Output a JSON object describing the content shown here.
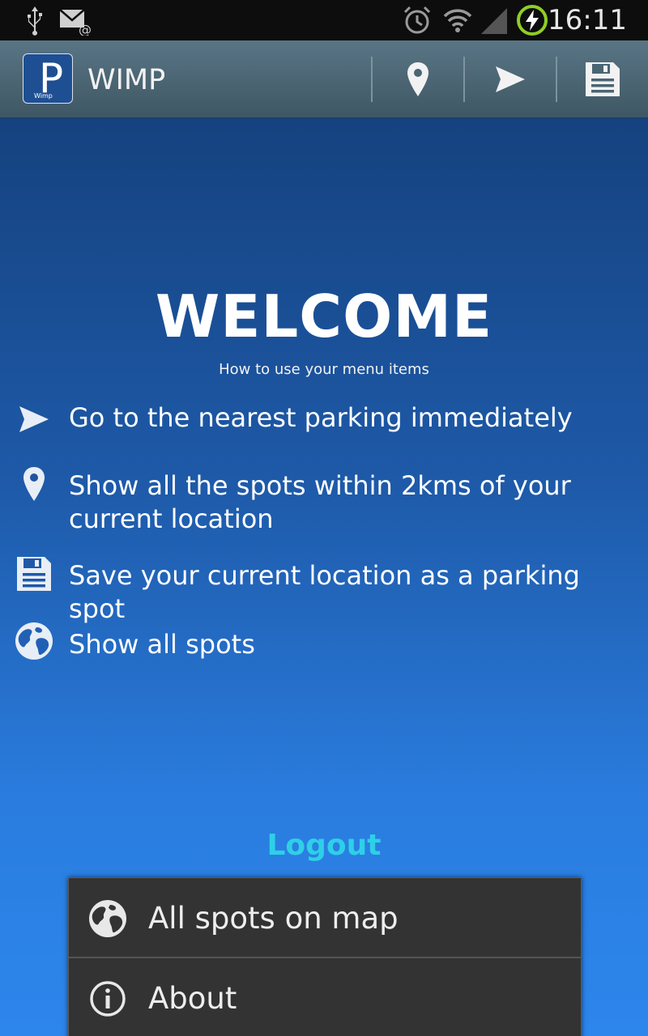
{
  "status_bar": {
    "time": "16:11",
    "icons": [
      "usb-icon",
      "email-icon",
      "alarm-icon",
      "wifi-icon",
      "signal-icon",
      "battery-charging-icon"
    ]
  },
  "action_bar": {
    "title": "WIMP",
    "logo_letter": "P",
    "logo_small_text": "Wimp",
    "actions": [
      "location-pin-icon",
      "send-icon",
      "save-icon"
    ]
  },
  "welcome": {
    "title": "WELCOME",
    "subtitle": "How to use your menu items"
  },
  "help_items": [
    {
      "icon": "send-icon",
      "text": "Go to the nearest parking immediately"
    },
    {
      "icon": "location-pin-icon",
      "text": "Show all the spots within 2kms of your current location"
    },
    {
      "icon": "save-icon",
      "text": "Save your current location as a parking spot"
    },
    {
      "icon": "globe-icon",
      "text": "Show all spots"
    }
  ],
  "logout_label": "Logout",
  "overflow_menu": {
    "items": [
      {
        "icon": "globe-icon",
        "label": "All spots on map"
      },
      {
        "icon": "info-icon",
        "label": "About"
      }
    ]
  },
  "colors": {
    "accent_link": "#2ed0e6",
    "background_top": "#15427f",
    "background_bottom": "#2d86ec",
    "action_bar": "#4a6573",
    "menu_background": "#333333"
  }
}
